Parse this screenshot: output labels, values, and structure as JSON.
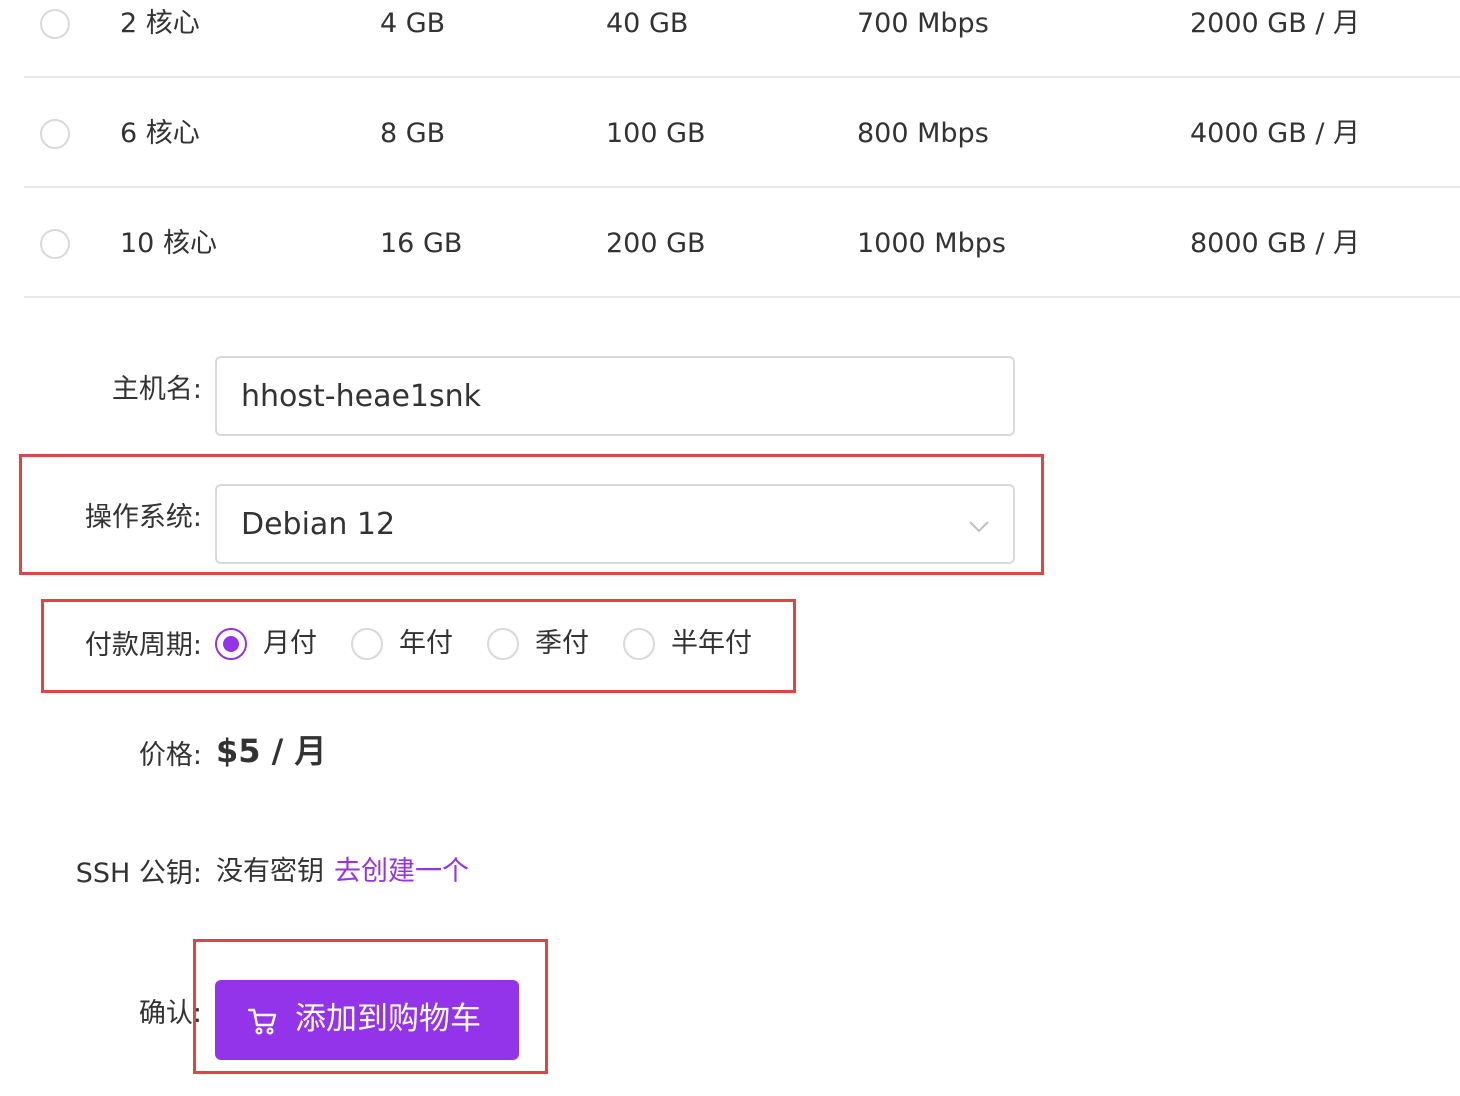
{
  "plans": [
    {
      "cpu": "2 核心",
      "memory": "4 GB",
      "disk": "40 GB",
      "bandwidth": "700 Mbps",
      "traffic": "2000 GB / 月"
    },
    {
      "cpu": "6 核心",
      "memory": "8 GB",
      "disk": "100 GB",
      "bandwidth": "800 Mbps",
      "traffic": "4000 GB / 月"
    },
    {
      "cpu": "10 核心",
      "memory": "16 GB",
      "disk": "200 GB",
      "bandwidth": "1000 Mbps",
      "traffic": "8000 GB / 月"
    }
  ],
  "form": {
    "hostname_label": "主机名:",
    "hostname_value": "hhost-heae1snk",
    "os_label": "操作系统:",
    "os_value": "Debian 12",
    "billing_label": "付款周期:",
    "billing_options": [
      "月付",
      "年付",
      "季付",
      "半年付"
    ],
    "billing_selected": "月付",
    "price_label": "价格:",
    "price_value": "$5 / 月",
    "ssh_label": "SSH 公钥:",
    "ssh_text": "没有密钥",
    "ssh_link": "去创建一个",
    "confirm_label": "确认:",
    "cart_button": "添加到购物车"
  },
  "colors": {
    "accent": "#9333ea",
    "highlight": "#e04545",
    "border": "#d9d9d9"
  },
  "icons": {
    "select_arrow": "chevron-down-icon",
    "cart": "shopping-cart-icon"
  }
}
